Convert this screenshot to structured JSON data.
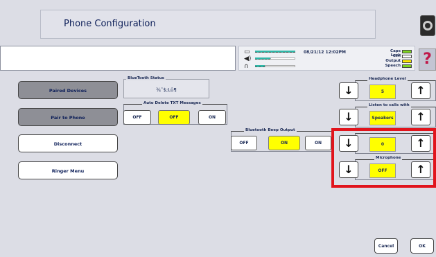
{
  "title": "Phone Configuration",
  "status": {
    "datetime": "08/21/12 12:02PM",
    "indicators": [
      {
        "label": "Caps Lock"
      },
      {
        "label": "Ctrl"
      },
      {
        "label": "Output"
      },
      {
        "label": "Speech"
      }
    ],
    "help_label": "?"
  },
  "sidebar": [
    {
      "label": "Paired Devices",
      "style": "gray"
    },
    {
      "label": "Pair to Phone",
      "style": "gray"
    },
    {
      "label": "Disconnect",
      "style": "white"
    },
    {
      "label": "Ringer Menu",
      "style": "white"
    }
  ],
  "bluetooth_status": {
    "label": "BlueTooth Status",
    "value": "¾˜$;Lû¶"
  },
  "auto_delete": {
    "label": "Auto Delete TXT Messages",
    "options": [
      "OFF",
      "OFF",
      "ON"
    ],
    "selected_index": 1
  },
  "beep_output": {
    "label": "Bluetooth Beep Output",
    "options": [
      "OFF",
      "ON",
      "ON"
    ],
    "selected_index": 1
  },
  "steppers": [
    {
      "label": "Headphone Level",
      "value": "5"
    },
    {
      "label": "Listen to calls with",
      "value": "Speakers"
    },
    {
      "label": "",
      "value": "0"
    },
    {
      "label": "Microphone",
      "value": "OFF"
    }
  ],
  "arrows": {
    "down": "↓",
    "up": "↑"
  },
  "footer": {
    "cancel": "Cancel",
    "ok": "OK"
  },
  "colors": {
    "highlight": "#e1141c",
    "selected": "#ffff00",
    "background": "#dcdde5"
  }
}
